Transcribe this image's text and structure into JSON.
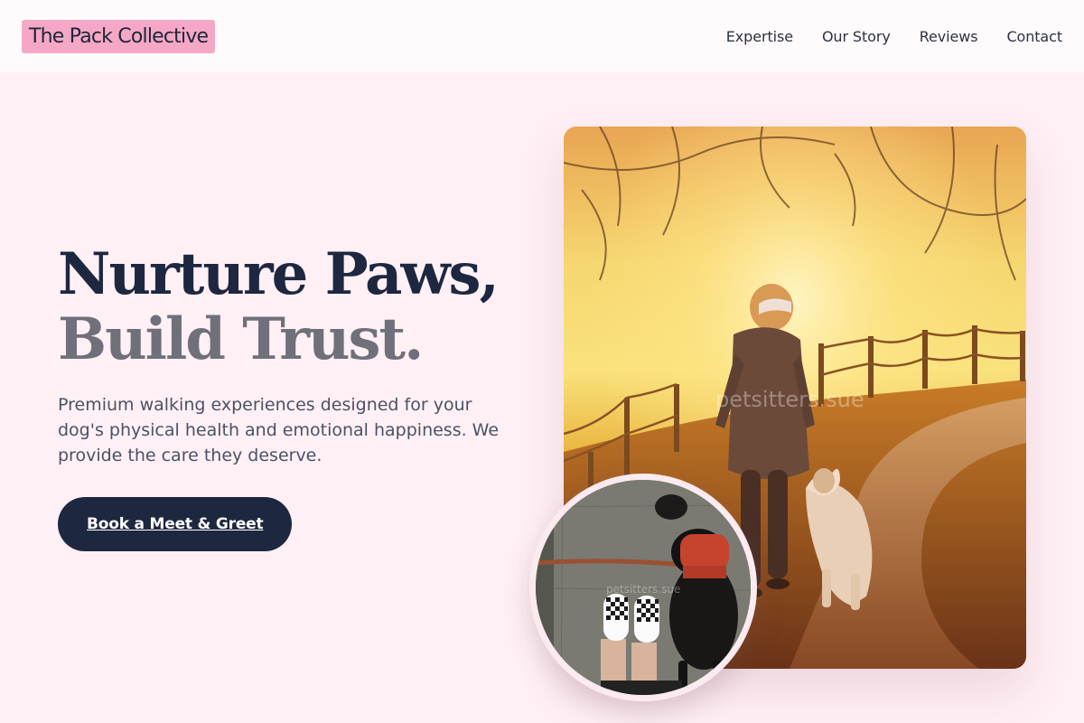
{
  "brand": {
    "name": "The Pack Collective",
    "accent": "#f5a8c6"
  },
  "nav": {
    "items": [
      {
        "label": "Expertise"
      },
      {
        "label": "Our Story"
      },
      {
        "label": "Reviews"
      },
      {
        "label": "Contact"
      }
    ]
  },
  "hero": {
    "headline_line1": "Nurture Paws,",
    "headline_line2": "Build Trust.",
    "description": "Premium walking experiences designed for your dog's physical health and emotional happiness. We provide the care they deserve.",
    "cta_label": "Book a Meet & Greet",
    "main_image": {
      "alt": "Person walking a dog along a sunset trail",
      "watermark": "petsitters.sue"
    },
    "inset_image": {
      "alt": "Overhead view of checkered shoes and a dog on a leash",
      "watermark": "petsitters.sue"
    }
  },
  "colors": {
    "background": "#fff0f5",
    "header_bg": "#fffbfc",
    "navy": "#1e2740",
    "gray_headline": "#6f7079"
  }
}
